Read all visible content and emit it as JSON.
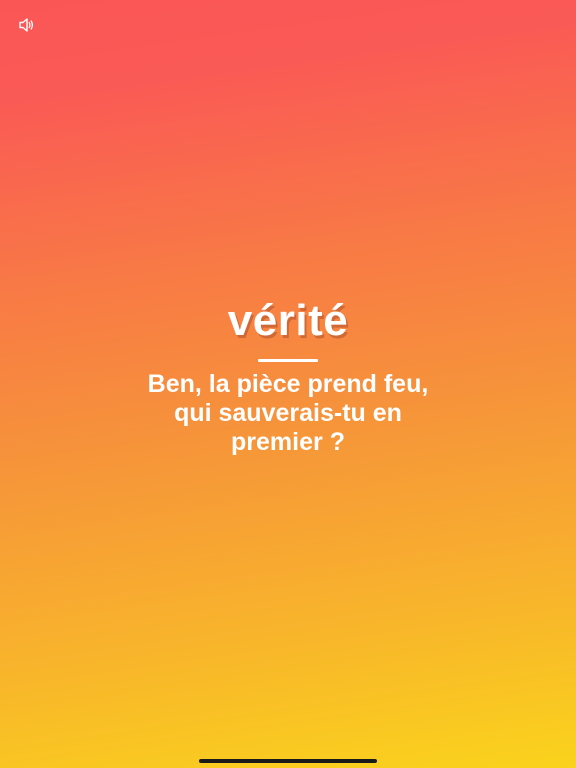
{
  "header": {
    "sound_icon": "speaker-volume-icon"
  },
  "card": {
    "mode": "vérité",
    "question": "Ben, la pièce prend feu, qui sauverais-tu en premier ?"
  },
  "colors": {
    "gradient_top": "#fa5656",
    "gradient_middle": "#f6943a",
    "gradient_bottom": "#fad31c",
    "text": "#ffffff"
  }
}
